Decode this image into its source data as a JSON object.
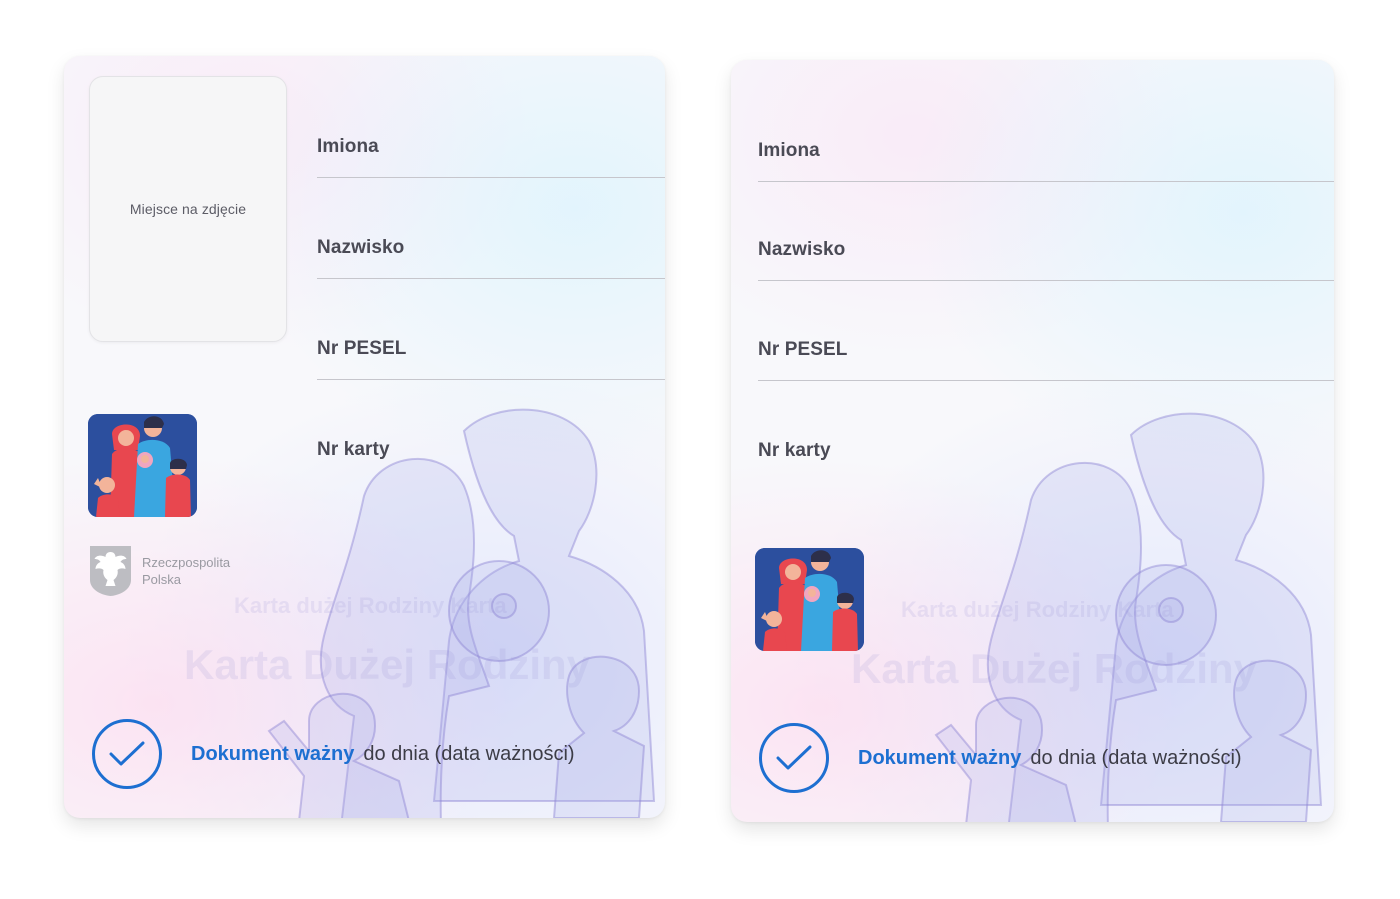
{
  "cards": [
    {
      "photo_placeholder": "Miejsce na zdjęcie",
      "fields": [
        {
          "label": "Imiona"
        },
        {
          "label": "Nazwisko"
        },
        {
          "label": "Nr PESEL"
        },
        {
          "label": "Nr karty"
        }
      ],
      "emblem_text_line1": "Rzeczpospolita",
      "emblem_text_line2": "Polska",
      "watermark_small": "Karta dużej Rodziny   Karta",
      "watermark_large": "Karta Dużej Rodziny",
      "validity_strong": "Dokument ważny",
      "validity_rest": "do dnia (data ważności)"
    },
    {
      "fields": [
        {
          "label": "Imiona"
        },
        {
          "label": "Nazwisko"
        },
        {
          "label": "Nr PESEL"
        },
        {
          "label": "Nr karty"
        }
      ],
      "watermark_small": "Karta dużej Rodziny   Karta",
      "watermark_large": "Karta Dużej Rodziny",
      "validity_strong": "Dokument ważny",
      "validity_rest": "do dnia (data ważności)"
    }
  ],
  "colors": {
    "accent_blue": "#1d6fd1",
    "label_gray": "#4a4a55",
    "icon_background": "#2c4f9e"
  },
  "icons": {
    "family": "family-icon",
    "emblem": "white-eagle-emblem-icon",
    "check": "checkmark-icon"
  }
}
